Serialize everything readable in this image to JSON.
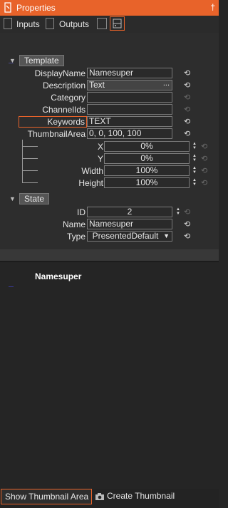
{
  "window": {
    "title": "Properties",
    "pin_glyph": "†"
  },
  "tabs": [
    {
      "label": "Inputs"
    },
    {
      "label": "Outputs"
    }
  ],
  "template_group": {
    "label": "Template",
    "rows": [
      {
        "name": "DisplayName",
        "value": "Namesuper"
      },
      {
        "name": "Description",
        "value": "Text",
        "button": "..."
      },
      {
        "name": "Category",
        "value": ""
      },
      {
        "name": "ChannelIds",
        "value": ""
      },
      {
        "name": "Keywords",
        "value": "TEXT"
      },
      {
        "name": "ThumbnailArea",
        "value": "0, 0, 100, 100"
      }
    ],
    "sub_rows": [
      {
        "name": "X",
        "value": "0%"
      },
      {
        "name": "Y",
        "value": "0%"
      },
      {
        "name": "Width",
        "value": "100%"
      },
      {
        "name": "Height",
        "value": "100%"
      }
    ]
  },
  "state_group": {
    "label": "State",
    "rows": [
      {
        "name": "ID",
        "value": "2"
      },
      {
        "name": "Name",
        "value": "Namesuper"
      },
      {
        "name": "Type",
        "value": "PresentedDefault"
      }
    ]
  },
  "preview": {
    "title": "Namesuper"
  },
  "bottom": {
    "show_thumbnail_label": "Show Thumbnail Area",
    "create_thumbnail_label": "Create Thumbnail"
  },
  "colors": {
    "accent": "#e8632a",
    "background": "#252525",
    "panel": "#2d2d2d"
  },
  "icons": [
    "document-icon",
    "pin-icon",
    "collapse-icon",
    "reset-icon",
    "spinner-icon",
    "camera-icon",
    "dropdown-arrow-icon"
  ]
}
